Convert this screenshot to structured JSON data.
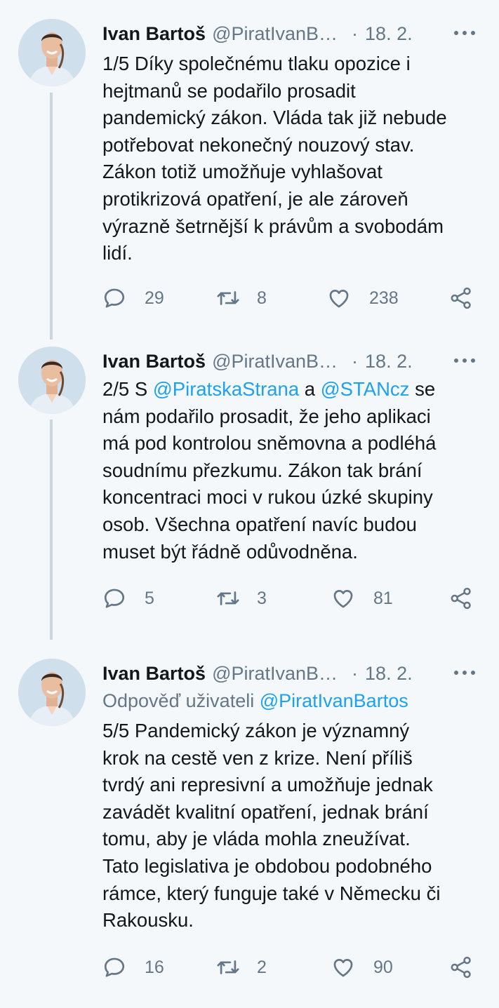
{
  "tweets": [
    {
      "name": "Ivan Bartoš",
      "handle": "@PiratIvanB…",
      "dot": "·",
      "date": "18. 2.",
      "lines": [
        "1/5 Díky společnému tlaku opozice i",
        "hejtmanů se podařilo prosadit",
        "pandemický zákon. Vláda tak již nebude",
        "potřebovat nekonečný nouzový stav.",
        "Zákon totiž umožňuje vyhlašovat",
        "protikrizová opatření, je ale zároveň",
        "výrazně šetrnější k právům a svobodám",
        "lidí."
      ],
      "replies": "29",
      "retweets": "8",
      "likes": "238"
    },
    {
      "name": "Ivan Bartoš",
      "handle": "@PiratIvanB…",
      "dot": "·",
      "date": "18. 2.",
      "line1_pre": "2/5 S ",
      "mention1": "@PiratskaStrana",
      "line1_mid": " a ",
      "mention2": "@STANcz",
      "line1_post": " se",
      "lines": [
        "nám podařilo prosadit, že jeho aplikaci",
        "má pod kontrolou sněmovna a podléhá",
        "soudnímu přezkumu. Zákon tak brání",
        "koncentraci moci v rukou úzké skupiny",
        "osob. Všechna opatření navíc budou",
        "muset být řádně odůvodněna."
      ],
      "replies": "5",
      "retweets": "3",
      "likes": "81"
    },
    {
      "name": "Ivan Bartoš",
      "handle": "@PiratIvanB…",
      "dot": "·",
      "date": "18. 2.",
      "reply_label": "Odpověď uživateli ",
      "reply_mention": "@PiratIvanBartos",
      "lines": [
        "5/5 Pandemický zákon je významný",
        "krok na cestě ven z krize. Není příliš",
        "tvrdý ani represivní a umožňuje jednak",
        "zavádět kvalitní opatření, jednak brání",
        "tomu, aby je vláda mohla zneužívat.",
        "Tato legislativa je obdobou podobného",
        "rámce, který funguje také v Německu či",
        "Rakousku."
      ],
      "replies": "16",
      "retweets": "2",
      "likes": "90"
    }
  ],
  "icons": {
    "reply": "reply-icon",
    "retweet": "retweet-icon",
    "like": "heart-icon",
    "share": "share-icon",
    "more": "more-icon"
  },
  "colors": {
    "background": "#f5f8fa",
    "text": "#14171a",
    "muted": "#657786",
    "link": "#1da1f2",
    "thread_line": "#ccd6dd"
  }
}
